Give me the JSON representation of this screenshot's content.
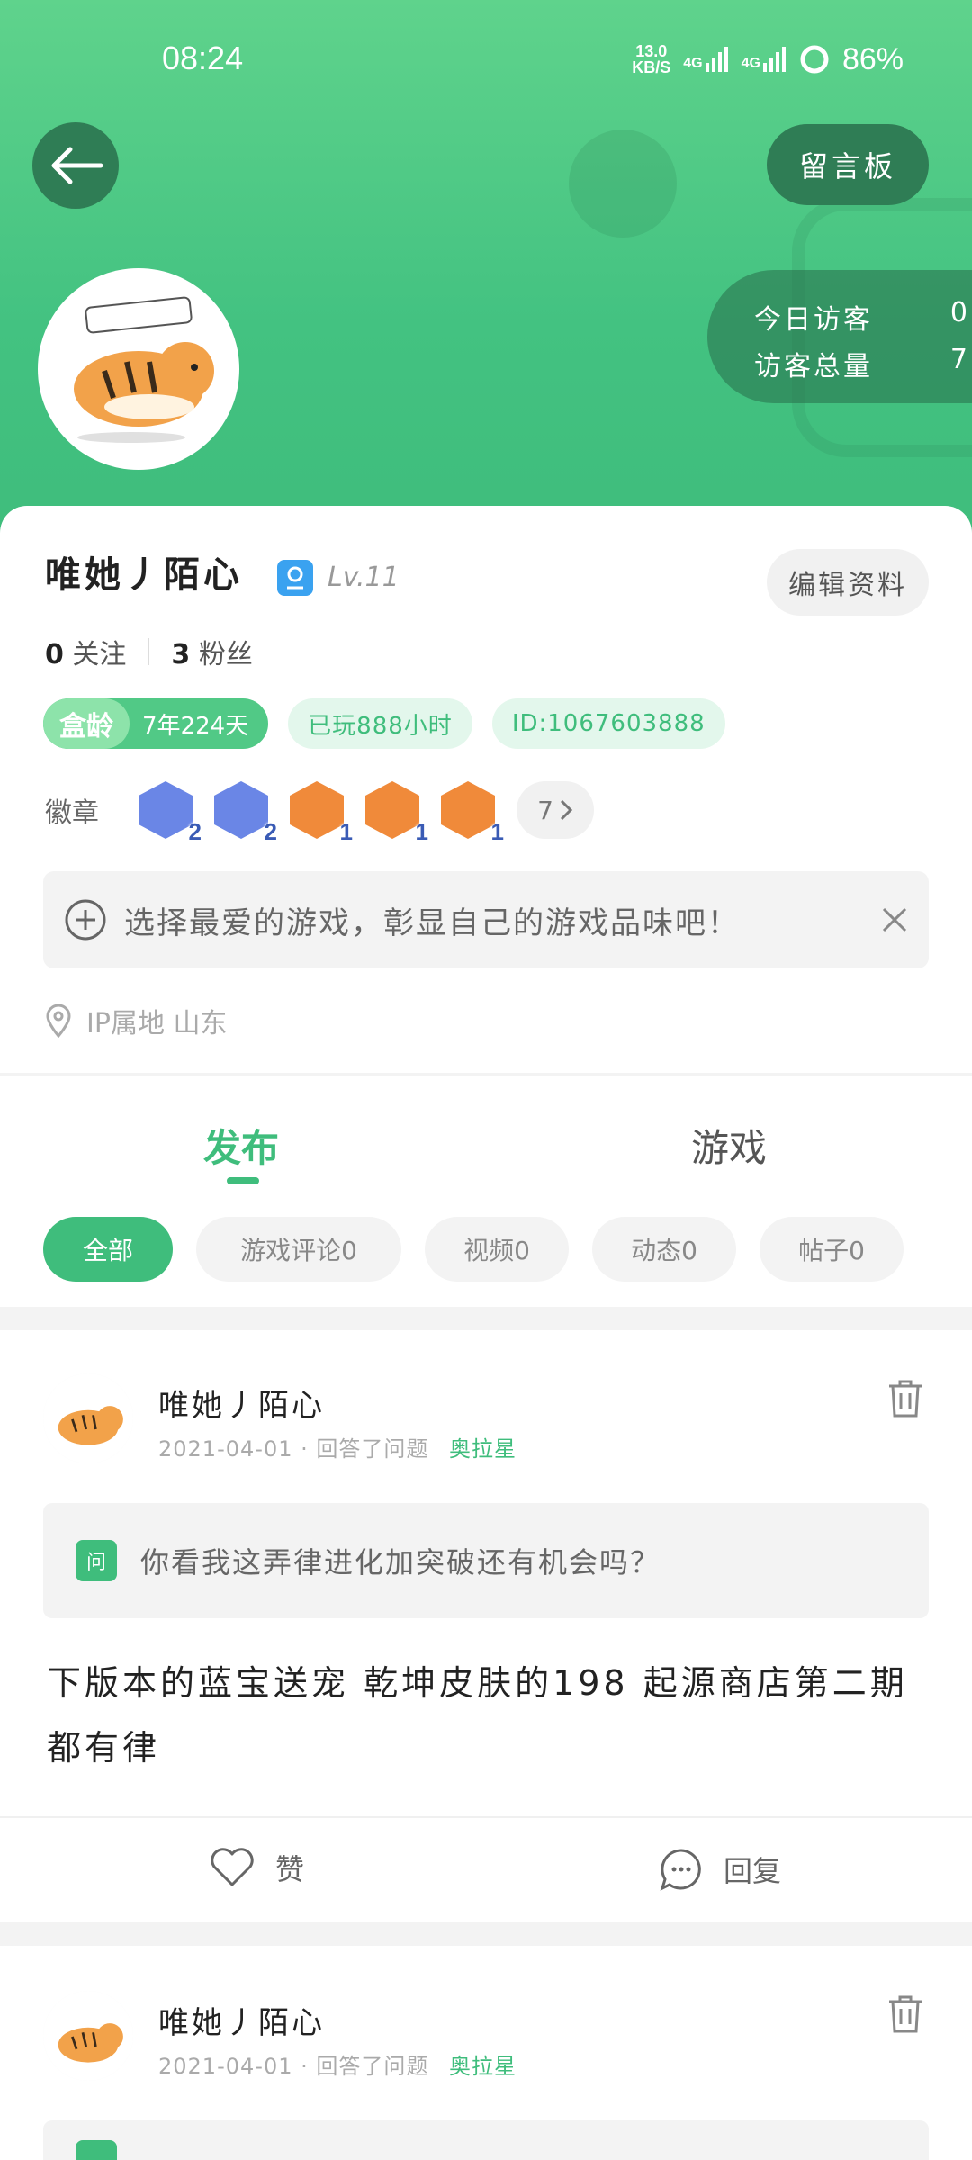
{
  "status_bar": {
    "time": "08:24",
    "net_speed_value": "13.0",
    "net_speed_unit": "KB/S",
    "signal1": "4G",
    "signal2": "4G",
    "battery": "86%"
  },
  "header": {
    "board_button": "留言板",
    "visitors": {
      "today_label": "今日访客",
      "today_value": "0",
      "total_label": "访客总量",
      "total_value": "7"
    }
  },
  "profile": {
    "name": "唯她丿陌心",
    "level": "Lv.11",
    "edit_button": "编辑资料",
    "following_count": "0",
    "following_label": "关注",
    "fans_count": "3",
    "fans_label": "粉丝",
    "box_age_label": "盒龄",
    "box_age_value": "7年224天",
    "played_hours": "已玩888小时",
    "user_id": "ID:1067603888",
    "badges_label": "徽章",
    "badges": [
      {
        "name": "blue-badge-1",
        "count": "2",
        "color": "#6a86e6"
      },
      {
        "name": "blue-badge-2",
        "count": "2",
        "color": "#6a86e6"
      },
      {
        "name": "orange-badge-1",
        "count": "1",
        "color": "#f08a3a"
      },
      {
        "name": "orange-badge-2",
        "count": "1",
        "color": "#f08a3a"
      },
      {
        "name": "orange-badge-3",
        "count": "1",
        "color": "#f08a3a"
      }
    ],
    "badges_more": "7",
    "favorite_prompt": "选择最爱的游戏，彰显自己的游戏品味吧！",
    "ip_location": "IP属地 山东"
  },
  "tabs": {
    "publish": "发布",
    "games": "游戏"
  },
  "filters": [
    "全部",
    "游戏评论0",
    "视频0",
    "动态0",
    "帖子0"
  ],
  "posts": [
    {
      "author": "唯她丿陌心",
      "date": "2021-04-01",
      "action": "· 回答了问题",
      "game": "奥拉星",
      "question_badge": "问",
      "question": "你看我这弄律进化加突破还有机会吗？",
      "answer": "下版本的蓝宝送宠 乾坤皮肤的198 起源商店第二期都有律",
      "like_label": "赞",
      "reply_label": "回复"
    },
    {
      "author": "唯她丿陌心",
      "date": "2021-04-01",
      "action": "· 回答了问题",
      "game": "奥拉星"
    }
  ],
  "colors": {
    "brand_green": "#3fbd7c",
    "header_dark": "#2f7d55"
  }
}
